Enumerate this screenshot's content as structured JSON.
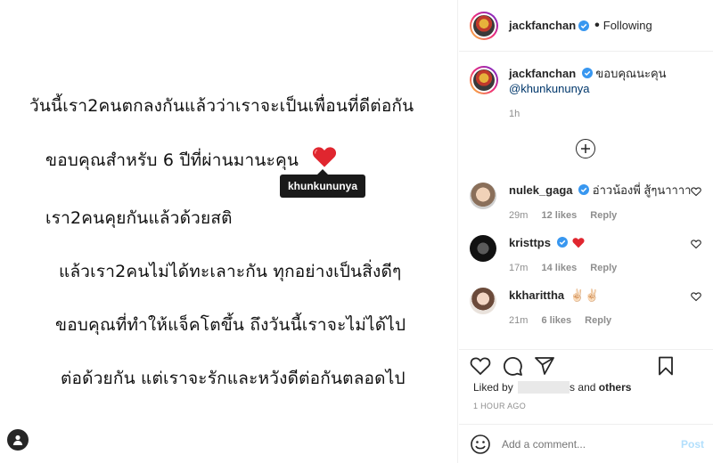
{
  "post": {
    "lines": [
      "วันนี้เรา2คนตกลงกันแล้วว่าเราจะเป็นเพื่อนที่ดีต่อกัน",
      "ขอบคุณสำหรับ 6 ปีที่ผ่านมานะคุน",
      "เรา2คนคุยกันแล้วด้วยสติ",
      "แล้วเรา2คนไม่ได้ทะเลาะกัน ทุกอย่างเป็นสิ่งดีๆ",
      "ขอบคุณที่ทำให้แจ็คโตขึ้น  ถึงวันนี้เราจะไม่ได้ไป",
      "ต่อด้วยกัน แต่เราจะรักและหวังดีต่อกันตลอดไป"
    ],
    "tag": "khunkununya"
  },
  "header": {
    "username": "jackfanchan",
    "separator": "•",
    "follow_status": "Following"
  },
  "caption": {
    "username": "jackfanchan",
    "text": "ขอบคุณนะคุน",
    "mention": "@khunkununya",
    "time": "1h"
  },
  "comments": [
    {
      "username": "nulek_gaga",
      "text": "อ่าวน้องพี่ สู้ๆนาาาา",
      "time": "29m",
      "likes": "12 likes",
      "reply": "Reply",
      "verified": true
    },
    {
      "username": "kristtps",
      "text": "",
      "time": "17m",
      "likes": "14 likes",
      "reply": "Reply",
      "verified": true,
      "emoji": "heart"
    },
    {
      "username": "kkharittha",
      "text": "✌🏻✌🏻",
      "time": "21m",
      "likes": "6 likes",
      "reply": "Reply",
      "verified": false
    }
  ],
  "footer": {
    "liked_by_prefix": "Liked by",
    "liked_by_suffix": "s",
    "liked_by_and": "and",
    "liked_by_others": "others",
    "time_ago": "1 HOUR AGO",
    "comment_placeholder": "Add a comment...",
    "post_label": "Post"
  },
  "colors": {
    "accent_blue": "#0095f6",
    "verified_blue": "#3897f0",
    "heart_red": "#ed4956",
    "post_disabled": "#b2dffc"
  },
  "icons": [
    "user-tag-icon",
    "verified-icon",
    "add-circle-icon",
    "heart-icon",
    "comment-icon",
    "share-icon",
    "bookmark-icon",
    "emoji-icon"
  ]
}
